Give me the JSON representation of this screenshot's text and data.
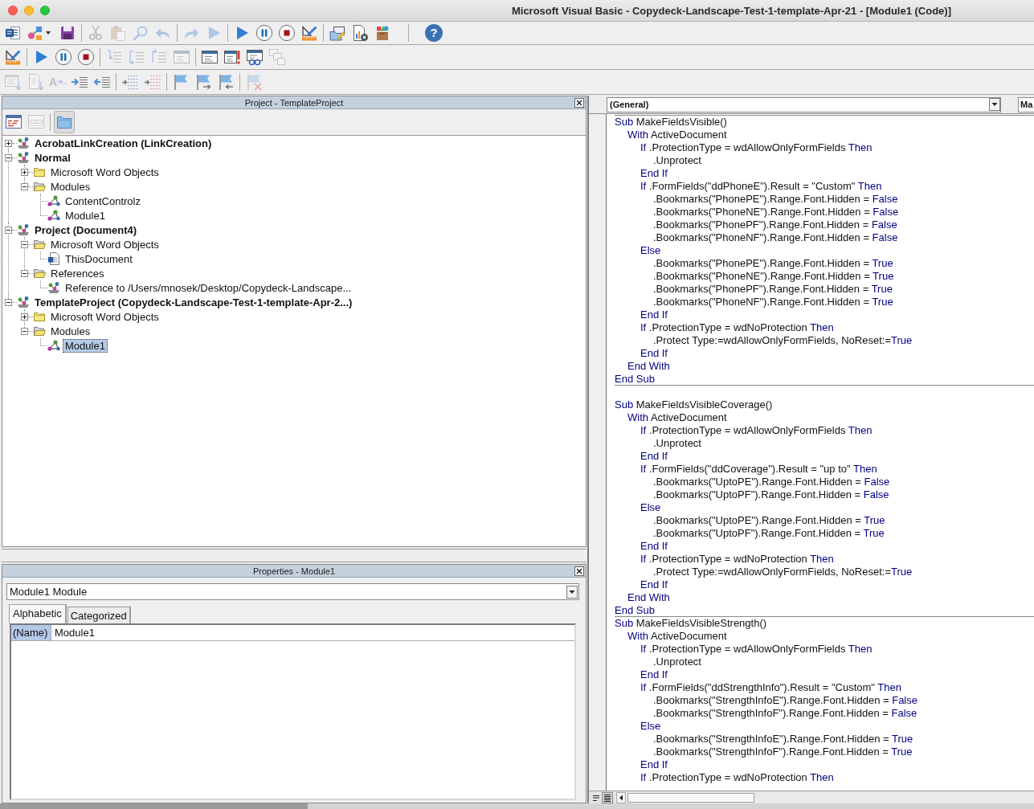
{
  "window": {
    "title": "Microsoft Visual Basic - Copydeck-Landscape-Test-1-template-Apr-21 - [Module1 (Code)]"
  },
  "toolbars": [
    {
      "groups": [
        {
          "buttons": [
            {
              "kind": "word",
              "disabled": false
            },
            {
              "kind": "insert",
              "disabled": false
            },
            {
              "kind": "save",
              "disabled": false
            }
          ]
        },
        {
          "buttons": [
            {
              "kind": "cut",
              "disabled": true
            },
            {
              "kind": "paste",
              "disabled": true
            },
            {
              "kind": "find",
              "disabled": true
            },
            {
              "kind": "undo",
              "disabled": true
            }
          ]
        },
        {
          "buttons": [
            {
              "kind": "redo",
              "disabled": true
            },
            {
              "kind": "run",
              "disabled": true
            }
          ]
        },
        {
          "buttons": [
            {
              "kind": "run",
              "disabled": false
            },
            {
              "kind": "pause",
              "disabled": false
            },
            {
              "kind": "stop",
              "disabled": false
            },
            {
              "kind": "design",
              "disabled": false
            }
          ]
        },
        {
          "buttons": [
            {
              "kind": "explorer",
              "disabled": false
            },
            {
              "kind": "properties",
              "disabled": false
            },
            {
              "kind": "toolbox",
              "disabled": false
            }
          ]
        },
        {
          "buttons": [
            {
              "kind": "help",
              "label": "?",
              "disabled": false
            }
          ]
        }
      ]
    },
    {
      "groups": [
        {
          "buttons": [
            {
              "kind": "design",
              "disabled": false
            }
          ]
        },
        {
          "buttons": [
            {
              "kind": "run",
              "disabled": false
            },
            {
              "kind": "pause",
              "disabled": false
            },
            {
              "kind": "stop",
              "disabled": false
            }
          ]
        },
        {
          "buttons": [
            {
              "kind": "step-into",
              "disabled": true
            },
            {
              "kind": "step-over",
              "disabled": true
            },
            {
              "kind": "step-out",
              "disabled": true
            },
            {
              "kind": "window",
              "disabled": true
            }
          ]
        },
        {
          "buttons": [
            {
              "kind": "locals",
              "disabled": false
            },
            {
              "kind": "immediate",
              "disabled": false
            },
            {
              "kind": "watch",
              "disabled": false
            },
            {
              "kind": "call-stack",
              "disabled": true
            }
          ]
        }
      ]
    },
    {
      "groups": [
        {
          "buttons": [
            {
              "kind": "list-members",
              "disabled": true
            },
            {
              "kind": "list-constants",
              "disabled": true
            },
            {
              "kind": "quick-info",
              "label": "A",
              "disabled": true
            },
            {
              "kind": "indent",
              "disabled": false
            },
            {
              "kind": "outdent",
              "disabled": false
            }
          ]
        },
        {
          "buttons": [
            {
              "kind": "comment",
              "disabled": false
            },
            {
              "kind": "uncomment",
              "disabled": false
            }
          ]
        },
        {
          "buttons": [
            {
              "kind": "bookmark",
              "disabled": false
            },
            {
              "kind": "next-bookmark",
              "disabled": false
            },
            {
              "kind": "previous-bookmark",
              "disabled": false
            }
          ]
        },
        {
          "buttons": [
            {
              "kind": "clear-bookmarks",
              "disabled": true
            }
          ]
        }
      ]
    }
  ],
  "project_explorer": {
    "title": "Project - TemplateProject",
    "toolbar": [
      {
        "kind": "view-code",
        "disabled": false,
        "on": false
      },
      {
        "kind": "view-object",
        "disabled": true,
        "on": false
      },
      {
        "kind": "toggle-folders",
        "disabled": false,
        "on": true
      }
    ],
    "tree": [
      {
        "label": "AcrobatLinkCreation (LinkCreation)",
        "kind": "project",
        "expanded": false,
        "selected": false
      },
      {
        "label": "Normal",
        "kind": "project",
        "expanded": true,
        "selected": false,
        "children": [
          {
            "label": "Microsoft Word Objects",
            "kind": "folder",
            "expanded": false,
            "selected": false
          },
          {
            "label": "Modules",
            "kind": "folder",
            "expanded": true,
            "selected": false,
            "children": [
              {
                "label": "ContentControlz",
                "kind": "module",
                "selected": false
              },
              {
                "label": "Module1",
                "kind": "module",
                "selected": false
              }
            ]
          }
        ]
      },
      {
        "label": "Project (Document4)",
        "kind": "project",
        "expanded": true,
        "selected": false,
        "children": [
          {
            "label": "Microsoft Word Objects",
            "kind": "folder",
            "expanded": true,
            "selected": false,
            "children": [
              {
                "label": "ThisDocument",
                "kind": "document",
                "selected": false
              }
            ]
          },
          {
            "label": "References",
            "kind": "folder",
            "expanded": true,
            "selected": false,
            "children": [
              {
                "label": "Reference to /Users/mnosek/Desktop/Copydeck-Landscape...",
                "kind": "reference",
                "selected": false
              }
            ]
          }
        ]
      },
      {
        "label": "TemplateProject (Copydeck-Landscape-Test-1-template-Apr-2...)",
        "kind": "project",
        "expanded": true,
        "selected": false,
        "children": [
          {
            "label": "Microsoft Word Objects",
            "kind": "folder",
            "expanded": false,
            "selected": false
          },
          {
            "label": "Modules",
            "kind": "folder",
            "expanded": true,
            "selected": false,
            "children": [
              {
                "label": "Module1",
                "kind": "module",
                "selected": true
              }
            ]
          }
        ]
      }
    ]
  },
  "properties": {
    "title": "Properties - Module1",
    "object": "Module1 Module",
    "tabs": [
      {
        "label": "Alphabetic",
        "selected": true
      },
      {
        "label": "Categorized",
        "selected": false
      }
    ],
    "rows": [
      {
        "name": "(Name)",
        "value": "Module1",
        "selected": true
      }
    ]
  },
  "code_window": {
    "object_box": "(General)",
    "procedure_box": "Ma",
    "procedures": [
      {
        "blank_line_before": false,
        "lines": [
          {
            "segments": [
              {
                "kind": "keyword",
                "text": "Sub"
              },
              {
                "kind": "text",
                "text": " MakeFieldsVisible()"
              }
            ],
            "children": [
              {
                "segments": [
                  {
                    "kind": "keyword",
                    "text": "With"
                  },
                  {
                    "kind": "text",
                    "text": " ActiveDocument"
                  }
                ],
                "children": [
                  {
                    "segments": [
                      {
                        "kind": "keyword",
                        "text": "If"
                      },
                      {
                        "kind": "text",
                        "text": " .ProtectionType = wdAllowOnlyFormFields "
                      },
                      {
                        "kind": "keyword",
                        "text": "Then"
                      }
                    ],
                    "children": [
                      {
                        "segments": [
                          {
                            "kind": "text",
                            "text": ".Unprotect"
                          }
                        ]
                      }
                    ]
                  },
                  {
                    "segments": [
                      {
                        "kind": "keyword",
                        "text": "End If"
                      }
                    ]
                  },
                  {
                    "segments": [
                      {
                        "kind": "keyword",
                        "text": "If"
                      },
                      {
                        "kind": "text",
                        "text": " .FormFields(\"ddPhoneE\").Result = \"Custom\" "
                      },
                      {
                        "kind": "keyword",
                        "text": "Then"
                      }
                    ],
                    "children": [
                      {
                        "segments": [
                          {
                            "kind": "text",
                            "text": ".Bookmarks(\"PhonePE\").Range.Font.Hidden = "
                          },
                          {
                            "kind": "keyword",
                            "text": "False"
                          }
                        ]
                      },
                      {
                        "segments": [
                          {
                            "kind": "text",
                            "text": ".Bookmarks(\"PhoneNE\").Range.Font.Hidden = "
                          },
                          {
                            "kind": "keyword",
                            "text": "False"
                          }
                        ]
                      },
                      {
                        "segments": [
                          {
                            "kind": "text",
                            "text": ".Bookmarks(\"PhonePF\").Range.Font.Hidden = "
                          },
                          {
                            "kind": "keyword",
                            "text": "False"
                          }
                        ]
                      },
                      {
                        "segments": [
                          {
                            "kind": "text",
                            "text": ".Bookmarks(\"PhoneNF\").Range.Font.Hidden = "
                          },
                          {
                            "kind": "keyword",
                            "text": "False"
                          }
                        ]
                      }
                    ]
                  },
                  {
                    "segments": [
                      {
                        "kind": "keyword",
                        "text": "Else"
                      }
                    ],
                    "children": [
                      {
                        "segments": [
                          {
                            "kind": "text",
                            "text": ".Bookmarks(\"PhonePE\").Range.Font.Hidden = "
                          },
                          {
                            "kind": "keyword",
                            "text": "True"
                          }
                        ]
                      },
                      {
                        "segments": [
                          {
                            "kind": "text",
                            "text": ".Bookmarks(\"PhoneNE\").Range.Font.Hidden = "
                          },
                          {
                            "kind": "keyword",
                            "text": "True"
                          }
                        ]
                      },
                      {
                        "segments": [
                          {
                            "kind": "text",
                            "text": ".Bookmarks(\"PhonePF\").Range.Font.Hidden = "
                          },
                          {
                            "kind": "keyword",
                            "text": "True"
                          }
                        ]
                      },
                      {
                        "segments": [
                          {
                            "kind": "text",
                            "text": ".Bookmarks(\"PhoneNF\").Range.Font.Hidden = "
                          },
                          {
                            "kind": "keyword",
                            "text": "True"
                          }
                        ]
                      }
                    ]
                  },
                  {
                    "segments": [
                      {
                        "kind": "keyword",
                        "text": "End If"
                      }
                    ]
                  },
                  {
                    "segments": [
                      {
                        "kind": "keyword",
                        "text": "If"
                      },
                      {
                        "kind": "text",
                        "text": " .ProtectionType = wdNoProtection "
                      },
                      {
                        "kind": "keyword",
                        "text": "Then"
                      }
                    ],
                    "children": [
                      {
                        "segments": [
                          {
                            "kind": "text",
                            "text": ".Protect Type:=wdAllowOnlyFormFields, NoReset:="
                          },
                          {
                            "kind": "keyword",
                            "text": "True"
                          }
                        ]
                      }
                    ]
                  },
                  {
                    "segments": [
                      {
                        "kind": "keyword",
                        "text": "End If"
                      }
                    ]
                  }
                ]
              },
              {
                "segments": [
                  {
                    "kind": "keyword",
                    "text": "End With"
                  }
                ]
              }
            ]
          },
          {
            "segments": [
              {
                "kind": "keyword",
                "text": "End Sub"
              }
            ]
          }
        ]
      },
      {
        "blank_line_before": true,
        "lines": [
          {
            "segments": [
              {
                "kind": "keyword",
                "text": "Sub"
              },
              {
                "kind": "text",
                "text": " MakeFieldsVisibleCoverage()"
              }
            ],
            "children": [
              {
                "segments": [
                  {
                    "kind": "keyword",
                    "text": "With"
                  },
                  {
                    "kind": "text",
                    "text": " ActiveDocument"
                  }
                ],
                "children": [
                  {
                    "segments": [
                      {
                        "kind": "keyword",
                        "text": "If"
                      },
                      {
                        "kind": "text",
                        "text": " .ProtectionType = wdAllowOnlyFormFields "
                      },
                      {
                        "kind": "keyword",
                        "text": "Then"
                      }
                    ],
                    "children": [
                      {
                        "segments": [
                          {
                            "kind": "text",
                            "text": ".Unprotect"
                          }
                        ]
                      }
                    ]
                  },
                  {
                    "segments": [
                      {
                        "kind": "keyword",
                        "text": "End If"
                      }
                    ]
                  },
                  {
                    "segments": [
                      {
                        "kind": "keyword",
                        "text": "If"
                      },
                      {
                        "kind": "text",
                        "text": " .FormFields(\"ddCoverage\").Result = \"up to\" "
                      },
                      {
                        "kind": "keyword",
                        "text": "Then"
                      }
                    ],
                    "children": [
                      {
                        "segments": [
                          {
                            "kind": "text",
                            "text": ".Bookmarks(\"UptoPE\").Range.Font.Hidden = "
                          },
                          {
                            "kind": "keyword",
                            "text": "False"
                          }
                        ]
                      },
                      {
                        "segments": [
                          {
                            "kind": "text",
                            "text": ".Bookmarks(\"UptoPF\").Range.Font.Hidden = "
                          },
                          {
                            "kind": "keyword",
                            "text": "False"
                          }
                        ]
                      }
                    ]
                  },
                  {
                    "segments": [
                      {
                        "kind": "keyword",
                        "text": "Else"
                      }
                    ],
                    "children": [
                      {
                        "segments": [
                          {
                            "kind": "text",
                            "text": ".Bookmarks(\"UptoPE\").Range.Font.Hidden = "
                          },
                          {
                            "kind": "keyword",
                            "text": "True"
                          }
                        ]
                      },
                      {
                        "segments": [
                          {
                            "kind": "text",
                            "text": ".Bookmarks(\"UptoPF\").Range.Font.Hidden = "
                          },
                          {
                            "kind": "keyword",
                            "text": "True"
                          }
                        ]
                      }
                    ]
                  },
                  {
                    "segments": [
                      {
                        "kind": "keyword",
                        "text": "End If"
                      }
                    ]
                  },
                  {
                    "segments": [
                      {
                        "kind": "keyword",
                        "text": "If"
                      },
                      {
                        "kind": "text",
                        "text": " .ProtectionType = wdNoProtection "
                      },
                      {
                        "kind": "keyword",
                        "text": "Then"
                      }
                    ],
                    "children": [
                      {
                        "segments": [
                          {
                            "kind": "text",
                            "text": ".Protect Type:=wdAllowOnlyFormFields, NoReset:="
                          },
                          {
                            "kind": "keyword",
                            "text": "True"
                          }
                        ]
                      }
                    ]
                  },
                  {
                    "segments": [
                      {
                        "kind": "keyword",
                        "text": "End If"
                      }
                    ]
                  }
                ]
              },
              {
                "segments": [
                  {
                    "kind": "keyword",
                    "text": "End With"
                  }
                ]
              }
            ]
          },
          {
            "segments": [
              {
                "kind": "keyword",
                "text": "End Sub"
              }
            ]
          }
        ]
      },
      {
        "blank_line_before": false,
        "lines": [
          {
            "segments": [
              {
                "kind": "keyword",
                "text": "Sub"
              },
              {
                "kind": "text",
                "text": " MakeFieldsVisibleStrength()"
              }
            ],
            "children": [
              {
                "segments": [
                  {
                    "kind": "keyword",
                    "text": "With"
                  },
                  {
                    "kind": "text",
                    "text": " ActiveDocument"
                  }
                ],
                "children": [
                  {
                    "segments": [
                      {
                        "kind": "keyword",
                        "text": "If"
                      },
                      {
                        "kind": "text",
                        "text": " .ProtectionType = wdAllowOnlyFormFields "
                      },
                      {
                        "kind": "keyword",
                        "text": "Then"
                      }
                    ],
                    "children": [
                      {
                        "segments": [
                          {
                            "kind": "text",
                            "text": ".Unprotect"
                          }
                        ]
                      }
                    ]
                  },
                  {
                    "segments": [
                      {
                        "kind": "keyword",
                        "text": "End If"
                      }
                    ]
                  },
                  {
                    "segments": [
                      {
                        "kind": "keyword",
                        "text": "If"
                      },
                      {
                        "kind": "text",
                        "text": " .FormFields(\"ddStrengthInfo\").Result = \"Custom\" "
                      },
                      {
                        "kind": "keyword",
                        "text": "Then"
                      }
                    ],
                    "children": [
                      {
                        "segments": [
                          {
                            "kind": "text",
                            "text": ".Bookmarks(\"StrengthInfoE\").Range.Font.Hidden = "
                          },
                          {
                            "kind": "keyword",
                            "text": "False"
                          }
                        ]
                      },
                      {
                        "segments": [
                          {
                            "kind": "text",
                            "text": ".Bookmarks(\"StrengthInfoF\").Range.Font.Hidden = "
                          },
                          {
                            "kind": "keyword",
                            "text": "False"
                          }
                        ]
                      }
                    ]
                  },
                  {
                    "segments": [
                      {
                        "kind": "keyword",
                        "text": "Else"
                      }
                    ],
                    "children": [
                      {
                        "segments": [
                          {
                            "kind": "text",
                            "text": ".Bookmarks(\"StrengthInfoE\").Range.Font.Hidden = "
                          },
                          {
                            "kind": "keyword",
                            "text": "True"
                          }
                        ]
                      },
                      {
                        "segments": [
                          {
                            "kind": "text",
                            "text": ".Bookmarks(\"StrengthInfoF\").Range.Font.Hidden = "
                          },
                          {
                            "kind": "keyword",
                            "text": "True"
                          }
                        ]
                      }
                    ]
                  },
                  {
                    "segments": [
                      {
                        "kind": "keyword",
                        "text": "End If"
                      }
                    ]
                  },
                  {
                    "segments": [
                      {
                        "kind": "keyword",
                        "text": "If"
                      },
                      {
                        "kind": "text",
                        "text": " .ProtectionType = wdNoProtection "
                      },
                      {
                        "kind": "keyword",
                        "text": "Then"
                      }
                    ]
                  }
                ]
              }
            ]
          }
        ]
      }
    ],
    "view_buttons": [
      {
        "kind": "procedure",
        "selected": false
      },
      {
        "kind": "module",
        "selected": true
      }
    ]
  }
}
